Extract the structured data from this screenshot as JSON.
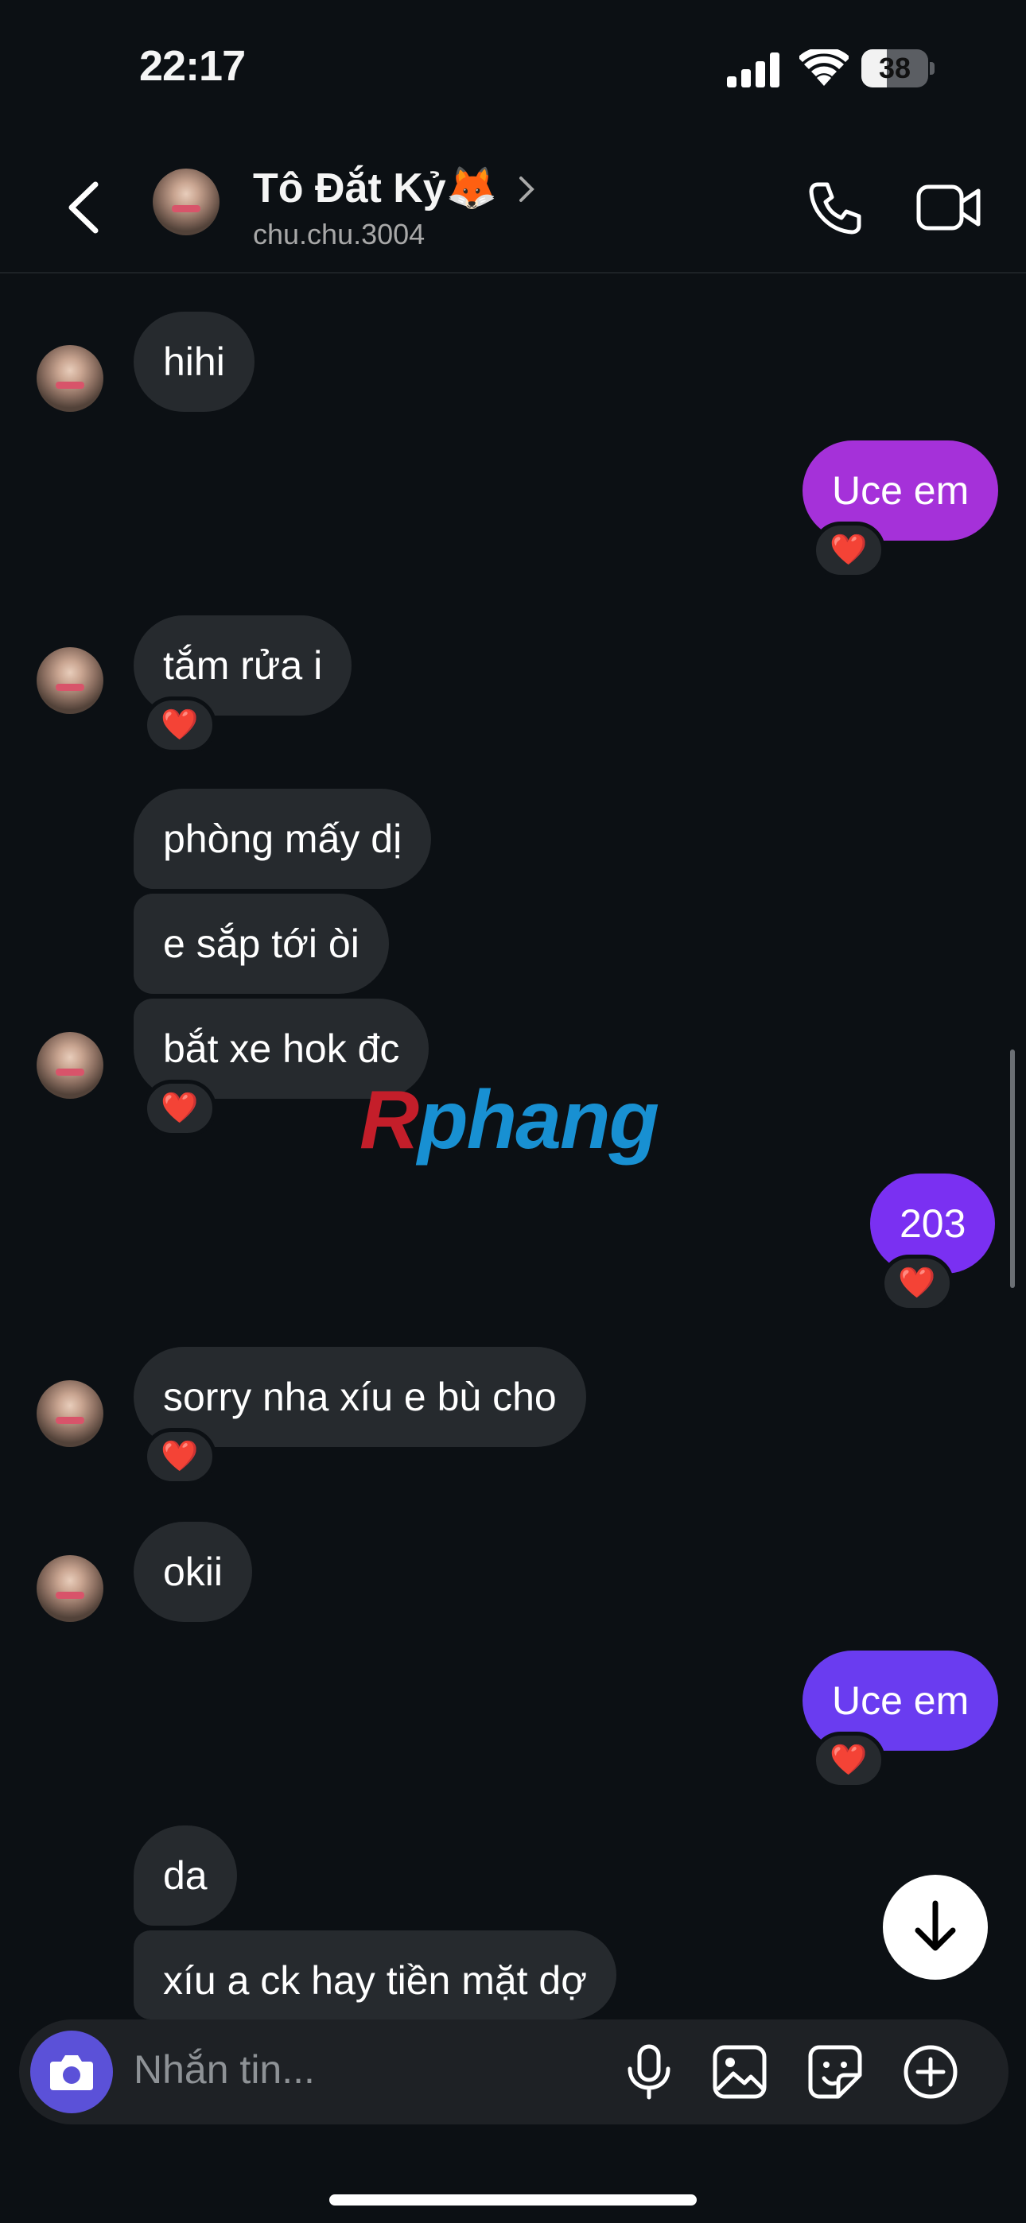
{
  "status": {
    "time": "22:17",
    "battery": "38",
    "battery_level": 0.38
  },
  "header": {
    "name": "Tô Đắt Kỷ🦊",
    "username": "chu.chu.3004"
  },
  "messages": [
    {
      "text": "hihi"
    },
    {
      "text": "Uce em"
    },
    {
      "text": "tắm rửa i"
    },
    {
      "text": "phòng mấy dị"
    },
    {
      "text": "e sắp tới òi"
    },
    {
      "text": "bắt xe hok đc"
    },
    {
      "text": "203"
    },
    {
      "text": "sorry nha xíu e bù cho"
    },
    {
      "text": "okii"
    },
    {
      "text": "Uce em"
    },
    {
      "text": "da"
    },
    {
      "text": "xíu a ck hay tiền mặt dợ"
    }
  ],
  "reaction": "❤️",
  "watermark": {
    "part1": "R",
    "part2": "phang"
  },
  "composer": {
    "placeholder": "Nhắn tin..."
  },
  "colors": {
    "bg": "#0c1014",
    "incoming": "#262a2e",
    "outgoing_top": "#a531d9",
    "outgoing_bottom": "#6a3cf0",
    "camera": "#5b51d8"
  }
}
